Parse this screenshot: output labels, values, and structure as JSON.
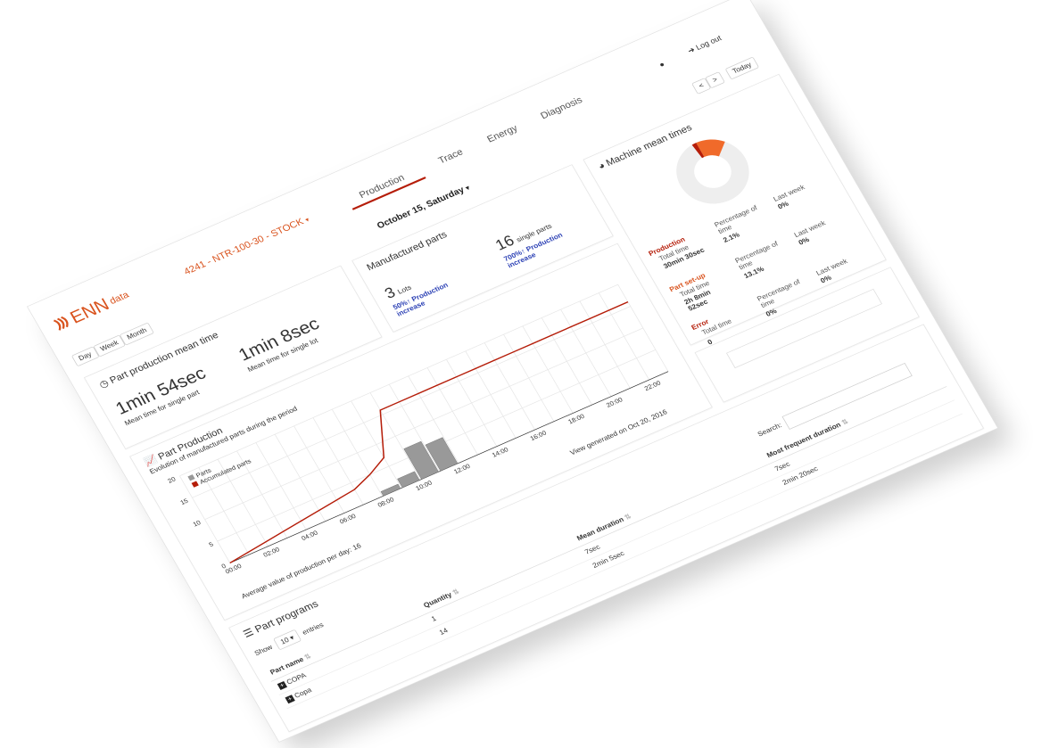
{
  "brand": {
    "logo_text": "ENN",
    "logo_sub": "data"
  },
  "header": {
    "machine_selector": "4241 - NTR-100-30 - STOCK",
    "logout_label": "Log out"
  },
  "tabs": [
    {
      "label": "Production",
      "active": true
    },
    {
      "label": "Trace",
      "active": false
    },
    {
      "label": "Energy",
      "active": false
    },
    {
      "label": "Diagnosis",
      "active": false
    }
  ],
  "date_nav": {
    "current_date": "October 15, Saturday",
    "today_label": "Today",
    "prev_label": "<",
    "next_label": ">"
  },
  "period_buttons": {
    "day": "Day",
    "week": "Week",
    "month": "Month"
  },
  "mean_time": {
    "title": "Part production mean time",
    "single_part_value": "1min 54sec",
    "single_part_label": "Mean time for single part",
    "single_lot_value": "1min 8sec",
    "single_lot_label": "Mean time for single lot"
  },
  "manufactured": {
    "title": "Manufactured parts",
    "lots_value": "3",
    "lots_label": "Lots",
    "lots_increase": "50%↑ Production increase",
    "single_value": "16",
    "single_label": "single parts",
    "single_increase": "700%↑ Production increase"
  },
  "machine_times": {
    "title": "Machine mean times",
    "rows": [
      {
        "name": "Production",
        "total_label": "Total time",
        "total_value": "30min 30sec",
        "pct_label": "Percentage of time",
        "pct_value": "2.1%",
        "last_label": "Last week",
        "last_value": "0%"
      },
      {
        "name": "Part set-up",
        "total_label": "Total time",
        "total_value": "2h 8min 52sec",
        "pct_label": "Percentage of time",
        "pct_value": "13.1%",
        "last_label": "Last week",
        "last_value": "0%"
      },
      {
        "name": "Error",
        "total_label": "Total time",
        "total_value": "0",
        "pct_label": "Percentage of time",
        "pct_value": "0%",
        "last_label": "Last week",
        "last_value": "0%"
      }
    ],
    "donut": {
      "production_pct": 2.1,
      "setup_pct": 13.1,
      "colors": {
        "production": "#b51d09",
        "setup": "#f06a2a",
        "rest": "#eeeeee"
      }
    }
  },
  "part_production": {
    "title": "Part Production",
    "subtitle": "Evolution of manufactured parts during the period",
    "average_text": "Average value of production per day: 16",
    "generated_text": "View generated on Oct 20, 2016"
  },
  "chart_data": {
    "type": "bar",
    "categories": [
      "00:00",
      "02:00",
      "04:00",
      "06:00",
      "08:00",
      "10:00",
      "12:00",
      "14:00",
      "16:00",
      "18:00",
      "20:00",
      "22:00"
    ],
    "x": [
      0,
      1,
      2,
      3,
      4,
      5,
      6,
      7,
      8,
      9,
      10,
      11,
      12,
      13,
      14,
      15,
      16,
      17,
      18,
      19,
      20,
      21,
      22,
      23
    ],
    "series": [
      {
        "name": "Parts",
        "kind": "bar",
        "color": "#999999",
        "values": [
          0,
          0,
          0,
          0,
          0,
          0,
          0,
          0,
          1,
          2,
          7,
          6,
          0,
          0,
          0,
          0,
          0,
          0,
          0,
          0,
          0,
          0,
          0,
          0
        ]
      },
      {
        "name": "Accumulated parts",
        "kind": "line",
        "color": "#b51d09",
        "values": [
          0,
          0.5,
          1,
          1.5,
          2,
          2.5,
          3,
          3.5,
          5,
          7,
          16,
          16,
          16,
          16,
          16,
          16,
          16,
          16,
          16,
          16,
          16,
          16,
          16,
          16
        ]
      }
    ],
    "yticks": [
      0,
      5,
      10,
      15,
      20
    ],
    "ylim": [
      0,
      20
    ],
    "grid": true,
    "legend_position": "top-left"
  },
  "part_programs": {
    "title": "Part programs",
    "show_label": "Show",
    "entries_value": "10",
    "entries_label": "entries",
    "search_label": "Search:",
    "columns": [
      "Part name",
      "Quantity",
      "Mean duration",
      "Most frequent duration"
    ],
    "rows": [
      {
        "name": "COPA",
        "quantity": "1",
        "mean": "7sec",
        "frequent": "7sec"
      },
      {
        "name": "Copa",
        "quantity": "14",
        "mean": "2min 5sec",
        "frequent": "2min 20sec"
      }
    ]
  },
  "colors": {
    "accent": "#d9531e",
    "dark_red": "#b51d09",
    "blue": "#2a3fb4"
  }
}
